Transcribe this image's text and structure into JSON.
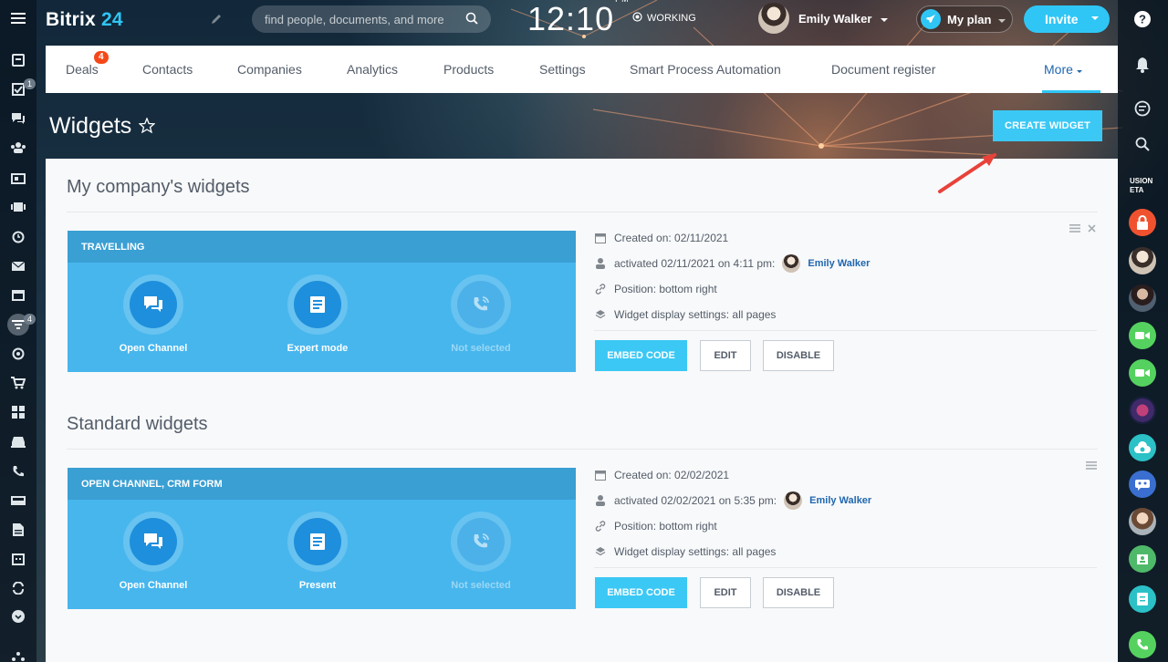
{
  "app": {
    "logo_main": "Bitrix",
    "logo_num": "24"
  },
  "search": {
    "placeholder": "find people, documents, and more"
  },
  "clock": {
    "time": "12:10",
    "ampm": "PM",
    "status": "WORKING"
  },
  "user": {
    "name": "Emily Walker"
  },
  "header_buttons": {
    "my_plan": "My plan",
    "invite": "Invite"
  },
  "left_rail": {
    "icons": [
      "menu-icon",
      "feed-icon",
      "tasks-icon",
      "chat-icon",
      "groups-icon",
      "contact-card-icon",
      "camera-icon",
      "clock-icon",
      "mail-icon",
      "calendar-window-icon",
      "crm-filter-icon",
      "target-icon",
      "cart-icon",
      "apps-icon",
      "car-icon",
      "phone-icon",
      "drive-icon",
      "document-icon",
      "planner-icon",
      "sync-icon",
      "more-icon",
      "sitemap-icon"
    ],
    "badges": {
      "tasks": "1",
      "crm": "4"
    }
  },
  "menu": {
    "items": [
      "Deals",
      "Contacts",
      "Companies",
      "Analytics",
      "Products",
      "Settings",
      "Smart Process Automation",
      "Document register"
    ],
    "deals_badge": "4",
    "more": "More"
  },
  "page": {
    "title": "Widgets",
    "create_button": "CREATE WIDGET"
  },
  "sections": [
    {
      "title": "My company's widgets",
      "widget": {
        "header": "TRAVELLING",
        "slots": [
          {
            "label": "Open Channel",
            "icon": "chat-bubbles-icon",
            "active": true
          },
          {
            "label": "Expert mode",
            "icon": "form-icon",
            "active": true
          },
          {
            "label": "Not selected",
            "icon": "phone-call-icon",
            "active": false
          }
        ]
      },
      "info": {
        "created": "Created on:  02/11/2021",
        "activated": "activated 02/11/2021 on 4:11 pm:",
        "activated_by": "Emily Walker",
        "position": "Position:  bottom right",
        "display": "Widget display settings:  all pages"
      },
      "buttons": {
        "embed": "EMBED CODE",
        "edit": "EDIT",
        "disable": "DISABLE"
      }
    },
    {
      "title": "Standard widgets",
      "widget": {
        "header": "OPEN CHANNEL, CRM FORM",
        "slots": [
          {
            "label": "Open Channel",
            "icon": "chat-bubbles-icon",
            "active": true
          },
          {
            "label": "Present",
            "icon": "form-icon",
            "active": true
          },
          {
            "label": "Not selected",
            "icon": "phone-call-icon",
            "active": false
          }
        ]
      },
      "info": {
        "created": "Created on:  02/02/2021",
        "activated": "activated 02/02/2021 on 5:35 pm:",
        "activated_by": "Emily Walker",
        "position": "Position:  bottom right",
        "display": "Widget display settings:  all pages"
      },
      "buttons": {
        "embed": "EMBED CODE",
        "edit": "EDIT",
        "disable": "DISABLE"
      }
    }
  ],
  "right_rail": {
    "items": [
      "help-icon",
      "bell-icon",
      "copilot-icon",
      "search-icon",
      "fusion-beta-logo",
      "lock-icon",
      "avatar",
      "avatar",
      "video-call-icon",
      "video-call-icon",
      "avatar",
      "cloud-icon",
      "group-chat-icon",
      "avatar",
      "crm-icon",
      "call-list-icon",
      "phone-icon"
    ],
    "fusion_label": "USION ETA"
  },
  "colors": {
    "accent": "#3bc8f5",
    "widget_bg": "#47b6ed",
    "widget_header": "#3a9fd3",
    "badge": "#f54819",
    "link": "#2067b0",
    "arrow": "#e8423a"
  }
}
